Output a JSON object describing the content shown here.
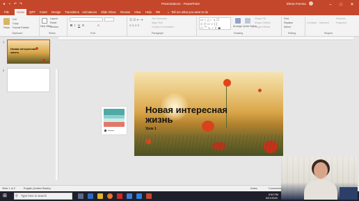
{
  "titlebar": {
    "title": "Presentation1 - PowerPoint",
    "user": "Elena Fomina",
    "minimize": "–",
    "maximize": "□",
    "close": "✕"
  },
  "tabs": [
    "File",
    "Home",
    "QRT",
    "Insert",
    "Design",
    "Transitions",
    "Animations",
    "Slide Show",
    "Review",
    "View",
    "Help",
    "RB"
  ],
  "tell_me": "Tell me what you want to do",
  "ribbon": {
    "paste": "Paste",
    "cut": "Cut",
    "copy": "Copy",
    "format_painter": "Format Painter",
    "new_slide": "New Slide",
    "layout": "Layout",
    "reset": "Reset",
    "section": "Section",
    "text_direction": "Text Direction",
    "align_text": "Align Text",
    "convert_smartart": "Convert to SmartArt",
    "arrange": "Arrange",
    "quick_styles": "Quick Styles",
    "shape_fill": "Shape Fill",
    "shape_outline": "Shape Outline",
    "shape_effects": "Shape Effects",
    "find": "Find",
    "replace": "Replace",
    "select": "Select",
    "combine": "Combine",
    "intersect": "Intersect",
    "subtract": "Subtract",
    "fragment": "Fragment",
    "groups": {
      "clipboard": "Clipboard",
      "slides": "Slides",
      "font": "Font",
      "paragraph": "Paragraph",
      "drawing": "Drawing",
      "editing": "Editing",
      "shapes": "Shapes"
    }
  },
  "thumbnails": [
    {
      "number": "1",
      "title": "Новая интересная жизнь"
    },
    {
      "number": "2",
      "title": ""
    }
  ],
  "slide": {
    "title": "Новая интересная жизнь",
    "subtitle": "Урок 1"
  },
  "status": {
    "slide_info": "Slide 1 of 2",
    "language": "English (United States)",
    "notes": "Notes",
    "comments": "Comments",
    "time": "9:53 PM",
    "date": "5/21/2020"
  },
  "taskbar": {
    "search_placeholder": "Type here to search"
  },
  "colors": {
    "accent": "#c4472b",
    "ribbon_bg": "#f3f3f3",
    "taskbar": "#1f1f2b"
  }
}
